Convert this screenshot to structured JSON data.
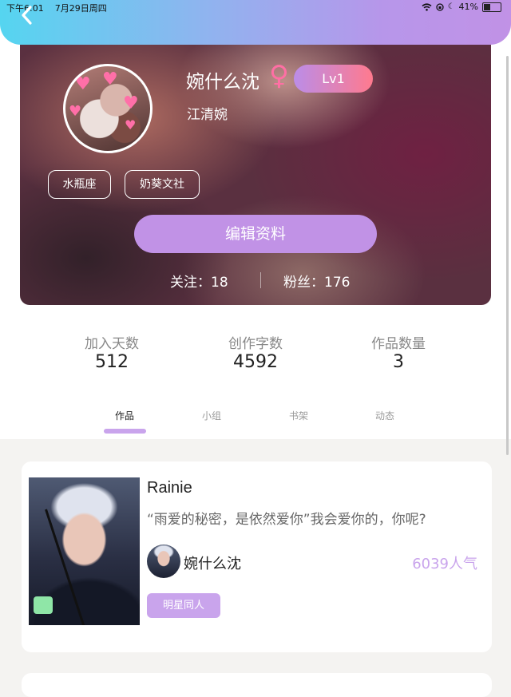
{
  "status_bar": {
    "time": "下午6:01",
    "date": "7月29日周四",
    "battery": "41%"
  },
  "profile": {
    "nickname": "婉什么沈",
    "gender_icon": "female-symbol-icon",
    "level": "Lv1",
    "real_name": "江清婉",
    "tags": [
      "水瓶座",
      "奶葵文社"
    ],
    "edit_button": "编辑资料",
    "following": "关注：18",
    "followers": "粉丝：176"
  },
  "stats": [
    {
      "label": "加入天数",
      "value": "512"
    },
    {
      "label": "创作字数",
      "value": "4592"
    },
    {
      "label": "作品数量",
      "value": "3"
    }
  ],
  "tabs": [
    "作品",
    "小组",
    "书架",
    "动态"
  ],
  "active_tab": "作品",
  "works": [
    {
      "title": "Rainie",
      "description": "“雨爱的秘密，是依然爱你”我会爱你的，你呢?",
      "author": "婉什么沈",
      "popularity": "6039人气",
      "category": "明星同人"
    }
  ],
  "colors": {
    "header_gradient_start": "#55d5f0",
    "header_gradient_end": "#c192e6",
    "accent_purple": "#c192e6",
    "light_purple": "#c9a4ec",
    "gender_pink": "#ff6fa4"
  }
}
